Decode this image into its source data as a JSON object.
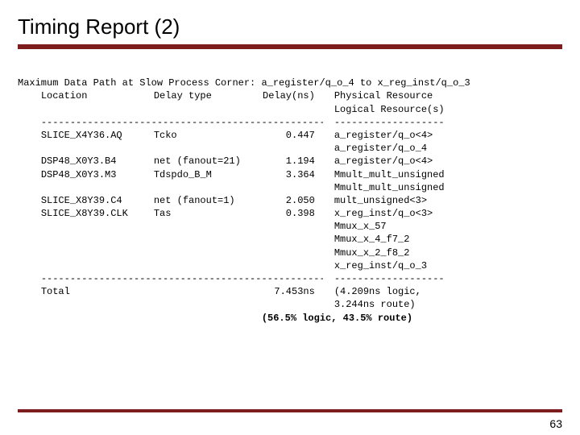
{
  "title": "Timing Report (2)",
  "header_line": "Maximum Data Path at Slow Process Corner: a_register/q_o_4 to x_reg_inst/q_o_3",
  "col_loc": "Location",
  "col_dtype": "Delay type",
  "col_delay": "Delay(ns)",
  "col_phys": "Physical Resource",
  "col_logi": "Logical Resource(s)",
  "dash": "-------------------------------------------------",
  "dash2": "-------------------",
  "rows": [
    {
      "loc": "SLICE_X4Y36.AQ",
      "dtype": "Tcko",
      "delay": "0.447",
      "phys": "a_register/q_o<4>",
      "logi": [
        "a_register/q_o_4"
      ]
    },
    {
      "loc": "DSP48_X0Y3.B4",
      "dtype": "net (fanout=21)",
      "delay": "1.194",
      "phys": "a_register/q_o<4>",
      "logi": []
    },
    {
      "loc": "DSP48_X0Y3.M3",
      "dtype": "Tdspdo_B_M",
      "delay": "3.364",
      "phys": "Mmult_mult_unsigned",
      "logi": [
        "Mmult_mult_unsigned"
      ]
    },
    {
      "loc": "SLICE_X8Y39.C4",
      "dtype": "net (fanout=1)",
      "delay": "2.050",
      "phys": "mult_unsigned<3>",
      "logi": []
    },
    {
      "loc": "SLICE_X8Y39.CLK",
      "dtype": "Tas",
      "delay": "0.398",
      "phys": "x_reg_inst/q_o<3>",
      "logi": [
        "Mmux_x_57",
        "Mmux_x_4_f7_2",
        "Mmux_x_2_f8_2",
        "x_reg_inst/q_o_3"
      ]
    }
  ],
  "total_label": "Total",
  "total_time": "7.453ns",
  "total_breakdown1a": "(4.209ns logic,",
  "total_breakdown1b": "3.244ns route)",
  "total_breakdown2": "(56.5% logic, 43.5% route)",
  "page": "63"
}
